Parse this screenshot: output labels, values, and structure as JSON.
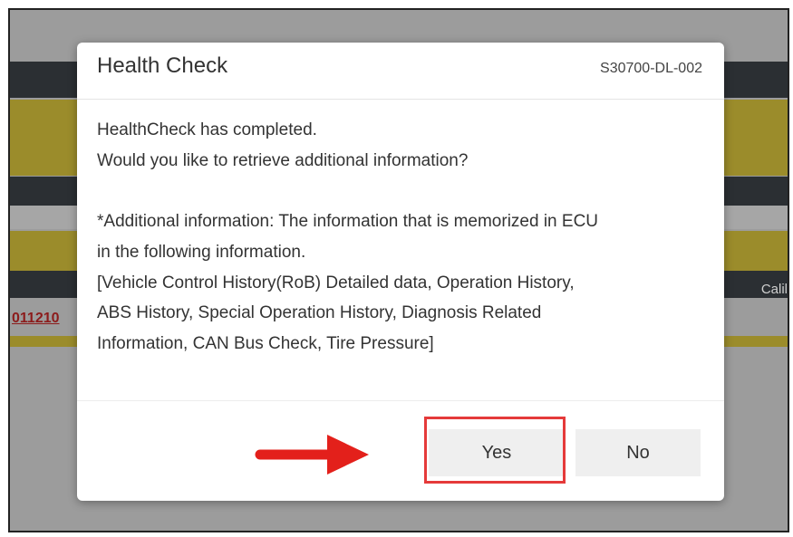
{
  "background": {
    "record_link_fragment": "011210",
    "column_fragment": "Calil"
  },
  "dialog": {
    "title": "Health Check",
    "code": "S30700-DL-002",
    "body_lines": [
      "HealthCheck has completed.",
      "Would you like to retrieve additional information?",
      "",
      "*Additional information: The information that is memorized in ECU",
      "in the following information.",
      "[Vehicle Control History(RoB) Detailed data, Operation History,",
      "ABS History, Special Operation History, Diagnosis Related",
      "Information, CAN Bus Check, Tire Pressure]"
    ],
    "yes_label": "Yes",
    "no_label": "No"
  },
  "annotation": {
    "highlight_color": "#e53a3a",
    "arrow_color": "#e3201b",
    "target": "yes-button"
  },
  "colors": {
    "background_dark_band": "#2b2f33",
    "background_yellow_band": "#9b8c2b",
    "overlay_gray": "#9c9c9c",
    "button_bg": "#efefef"
  }
}
